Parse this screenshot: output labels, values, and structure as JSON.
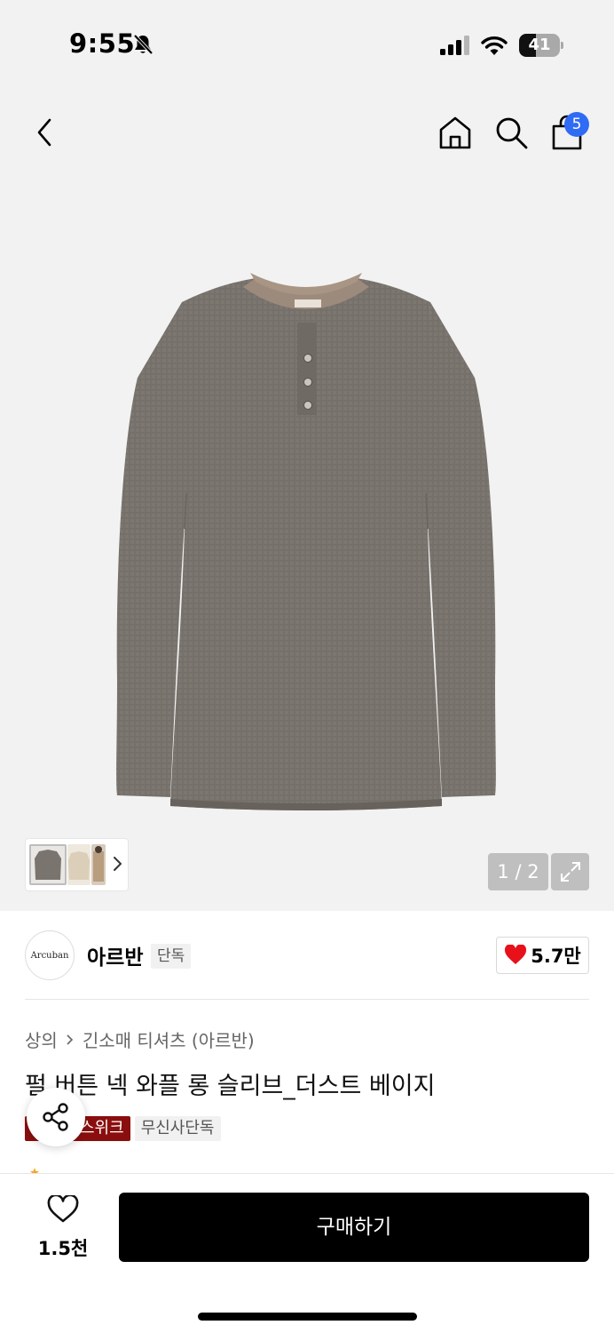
{
  "status_bar": {
    "time": "9:55",
    "battery_level": "41",
    "battery_fraction": 0.41
  },
  "nav": {
    "cart_count": "5",
    "icons": [
      "back-arrow-icon",
      "home-icon",
      "search-icon",
      "shopping-bag-icon"
    ]
  },
  "gallery": {
    "counter": "1 / 2",
    "thumbnails": [
      "product-front",
      "product-beige",
      "product-model"
    ]
  },
  "brand": {
    "logo_text": "Arcuban",
    "name": "아르반",
    "exclusive_label": "단독",
    "like_count": "5.7만"
  },
  "product": {
    "breadcrumb": [
      "상의",
      "긴소매 티셔츠 (아르반)"
    ],
    "title": "펄 버튼 넥 와플 롱 슬리브_더스트 베이지",
    "tags": [
      "스위크",
      "무신사단독"
    ]
  },
  "bottom_bar": {
    "wish_count": "1.5천",
    "buy_label": "구매하기"
  },
  "colors": {
    "accent_badge": "#2f6bf5",
    "week_tag": "#8b0e0e",
    "heart": "#e8111a",
    "buy_button": "#000000"
  }
}
